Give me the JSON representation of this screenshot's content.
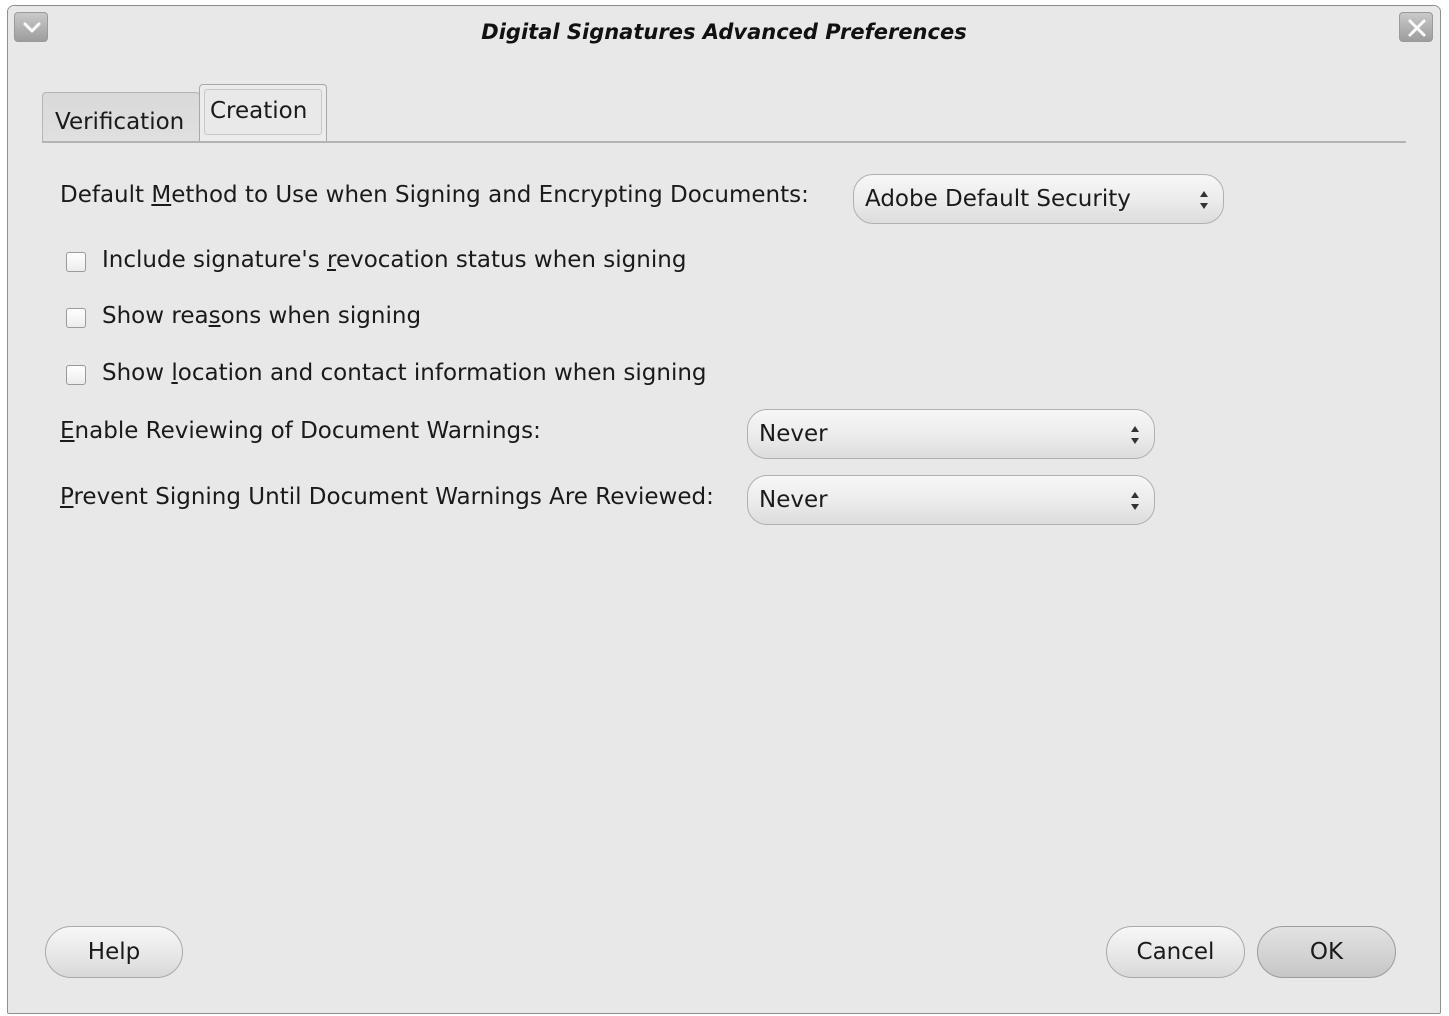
{
  "window": {
    "title": "Digital Signatures Advanced Preferences"
  },
  "tabs": [
    {
      "label": "Verification",
      "selected": false
    },
    {
      "label": "Creation",
      "selected": true
    }
  ],
  "creation": {
    "default_method": {
      "label_pre": "Default ",
      "label_u": "M",
      "label_post": "ethod to Use when Signing and Encrypting Documents:",
      "value": "Adobe Default Security"
    },
    "checkboxes": [
      {
        "pre": "Include signature's ",
        "u": "r",
        "post": "evocation status when signing",
        "checked": false
      },
      {
        "pre": "Show rea",
        "u": "s",
        "post": "ons when signing",
        "checked": false
      },
      {
        "pre": "Show ",
        "u": "l",
        "post": "ocation and contact information when signing",
        "checked": false
      }
    ],
    "enable_reviewing": {
      "label_u": "E",
      "label_post": "nable Reviewing of Document Warnings:",
      "value": "Never"
    },
    "prevent_signing": {
      "label_u": "P",
      "label_post": "revent Signing Until Document Warnings Are Reviewed:",
      "value": "Never"
    }
  },
  "buttons": {
    "help": "Help",
    "cancel": "Cancel",
    "ok": "OK"
  },
  "icons": {
    "window_menu": "chevron-down-icon",
    "window_close": "close-icon",
    "select_arrows": "up-down-arrows-icon"
  }
}
